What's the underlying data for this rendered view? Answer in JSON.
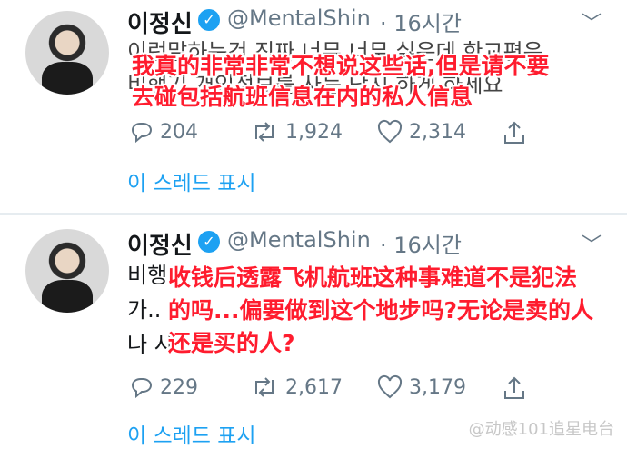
{
  "tweets": [
    {
      "name": "이정신",
      "handle": "@MentalShin",
      "time": "· 16시간",
      "text_line1": "이런말하는건 진짜 너무 너무 싫은데 한교편은",
      "text_line2": "비행기 개인정보를 사는 단지 하게 하세요",
      "overlay": "我真的非常非常不想说这些话,但是请不要\n去碰包括航班信息在内的私人信息",
      "replies": "204",
      "retweets": "1,924",
      "likes": "2,314",
      "thread_link": "이 스레드 표시"
    },
    {
      "name": "이정신",
      "handle": "@MentalShin",
      "time": "· 16시간",
      "text_line1": "비행",
      "text_line2": "가..",
      "text_line3": "나 사",
      "overlay": "收钱后透露飞机航班这种事难道不是犯法\n的吗...偏要做到这个地步吗?无论是卖的人\n还是买的人?",
      "replies": "229",
      "retweets": "2,617",
      "likes": "3,179",
      "thread_link": "이 스레드 표시"
    }
  ],
  "watermark": "@动感101追星电台",
  "colors": {
    "link": "#1da1f2",
    "overlay_text": "#ff1c2e",
    "meta": "#657786"
  }
}
